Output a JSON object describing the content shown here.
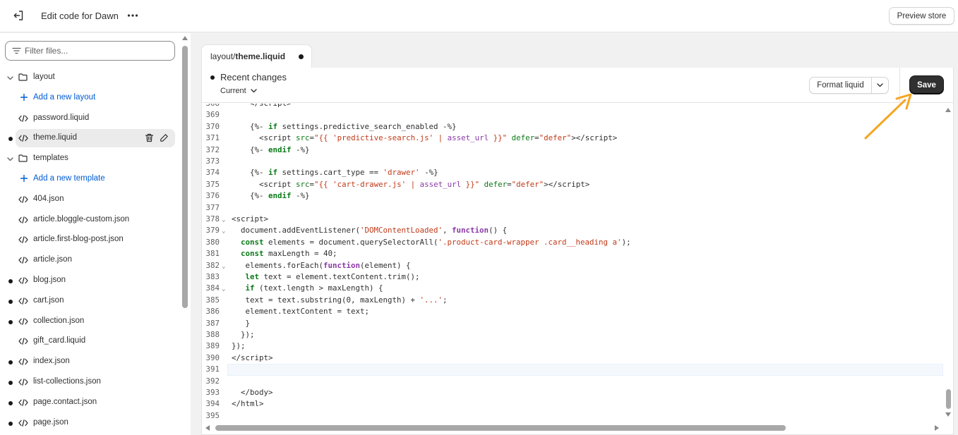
{
  "topbar": {
    "title": "Edit code for Dawn",
    "preview_label": "Preview store",
    "exit_icon": "exit-icon",
    "more_icon": "more-horizontal-icon"
  },
  "sidebar": {
    "filter_placeholder": "Filter files...",
    "items": [
      {
        "type": "folder",
        "label": "layout",
        "expanded": true,
        "unsaved": false
      },
      {
        "type": "add",
        "label": "Add a new layout"
      },
      {
        "type": "file",
        "label": "password.liquid",
        "unsaved": false
      },
      {
        "type": "file",
        "label": "theme.liquid",
        "unsaved": true,
        "active": true
      },
      {
        "type": "folder",
        "label": "templates",
        "expanded": true,
        "unsaved": false
      },
      {
        "type": "add",
        "label": "Add a new template"
      },
      {
        "type": "file",
        "label": "404.json",
        "unsaved": false
      },
      {
        "type": "file",
        "label": "article.bloggle-custom.json",
        "unsaved": false
      },
      {
        "type": "file",
        "label": "article.first-blog-post.json",
        "unsaved": false
      },
      {
        "type": "file",
        "label": "article.json",
        "unsaved": false
      },
      {
        "type": "file",
        "label": "blog.json",
        "unsaved": true
      },
      {
        "type": "file",
        "label": "cart.json",
        "unsaved": true
      },
      {
        "type": "file",
        "label": "collection.json",
        "unsaved": true
      },
      {
        "type": "file",
        "label": "gift_card.liquid",
        "unsaved": false
      },
      {
        "type": "file",
        "label": "index.json",
        "unsaved": true
      },
      {
        "type": "file",
        "label": "list-collections.json",
        "unsaved": true
      },
      {
        "type": "file",
        "label": "page.contact.json",
        "unsaved": true
      },
      {
        "type": "file",
        "label": "page.json",
        "unsaved": true
      }
    ]
  },
  "editor": {
    "tab": {
      "folder": "layout/",
      "file": "theme.liquid",
      "unsaved": true
    },
    "recent_changes_title": "Recent changes",
    "recent_changes_value": "Current",
    "format_label": "Format liquid",
    "save_label": "Save",
    "active_line": 391,
    "lines": [
      {
        "n": "368",
        "html": "    &lt;/script&gt;"
      },
      {
        "n": "369",
        "html": ""
      },
      {
        "n": "370",
        "html": "    {%- <span class=\"t-kw\">if</span> settings.predictive_search_enabled -%}"
      },
      {
        "n": "371",
        "html": "      &lt;script <span class=\"t-attr\">src</span>=<span class=\"t-str\">\"{{ </span><span class=\"t-str\">'predictive-search.js'</span><span class=\"t-str\"> | </span><span class=\"t-fn\">asset_url</span><span class=\"t-str\"> }}\"</span> <span class=\"t-attr\">defer</span>=<span class=\"t-str\">\"defer\"</span>&gt;&lt;/script&gt;"
      },
      {
        "n": "372",
        "html": "    {%- <span class=\"t-kw\">endif</span> -%}"
      },
      {
        "n": "373",
        "html": ""
      },
      {
        "n": "374",
        "html": "    {%- <span class=\"t-kw\">if</span> settings.cart_type == <span class=\"t-str\">'drawer'</span> -%}"
      },
      {
        "n": "375",
        "html": "      &lt;script <span class=\"t-attr\">src</span>=<span class=\"t-str\">\"{{ </span><span class=\"t-str\">'cart-drawer.js'</span><span class=\"t-str\"> | </span><span class=\"t-fn\">asset_url</span><span class=\"t-str\"> }}\"</span> <span class=\"t-attr\">defer</span>=<span class=\"t-str\">\"defer\"</span>&gt;&lt;/script&gt;"
      },
      {
        "n": "376",
        "html": "    {%- <span class=\"t-kw\">endif</span> -%}"
      },
      {
        "n": "377",
        "html": ""
      },
      {
        "n": "378",
        "html": "&lt;script&gt;",
        "fold": true
      },
      {
        "n": "379",
        "html": "  document.addEventListener(<span class=\"t-str\">'DOMContentLoaded'</span>, <span class=\"t-kwp\">function</span>() {",
        "fold": true
      },
      {
        "n": "380",
        "html": "  <span class=\"t-kw\">const</span> elements = document.querySelectorAll(<span class=\"t-str\">'.product-card-wrapper .card__heading a'</span>);"
      },
      {
        "n": "381",
        "html": "  <span class=\"t-kw\">const</span> maxLength = 40;"
      },
      {
        "n": "382",
        "html": "   elements.forEach(<span class=\"t-kwp\">function</span>(element) {",
        "fold": true
      },
      {
        "n": "383",
        "html": "   <span class=\"t-kw\">let</span> text = element.textContent.trim();"
      },
      {
        "n": "384",
        "html": "   <span class=\"t-kw\">if</span> (text.length &gt; maxLength) {",
        "fold": true
      },
      {
        "n": "385",
        "html": "   text = text.substring(0, maxLength) + <span class=\"t-str\">'...'</span>;"
      },
      {
        "n": "386",
        "html": "   element.textContent = text;"
      },
      {
        "n": "387",
        "html": "   }"
      },
      {
        "n": "388",
        "html": "  });"
      },
      {
        "n": "389",
        "html": "});"
      },
      {
        "n": "390",
        "html": "&lt;/script&gt;"
      },
      {
        "n": "391",
        "html": ""
      },
      {
        "n": "392",
        "html": ""
      },
      {
        "n": "393",
        "html": "  &lt;/body&gt;"
      },
      {
        "n": "394",
        "html": "&lt;/html&gt;"
      },
      {
        "n": "395",
        "html": ""
      }
    ]
  },
  "colors": {
    "accent_link": "#005bd3",
    "save_bg": "#303030",
    "annotation_arrow": "#f5a623"
  }
}
